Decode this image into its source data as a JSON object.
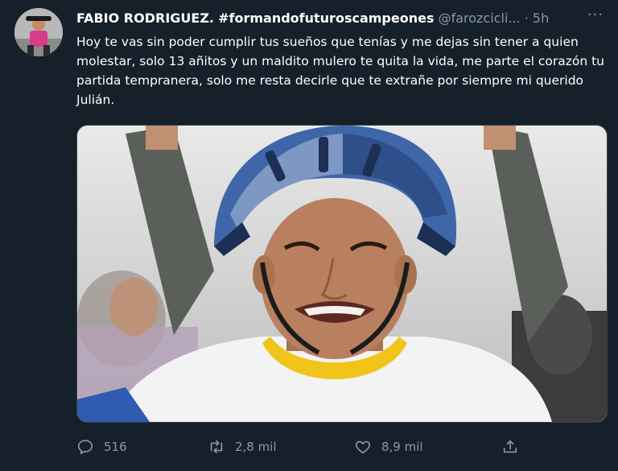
{
  "author": {
    "name": "FABIO RODRIGUEZ.",
    "hashtag": "#formandofuturoscampeones",
    "handle": "@farozcicli...",
    "separator": "·",
    "time": "5h"
  },
  "more_menu_glyph": "···",
  "tweet_text": "Hoy te vas sin poder cumplir tus sueños que tenías y me dejas sin tener a quien molestar, solo 13 añitos y un maldito mulero te quita la vida, me parte el corazón tu partida tempranera, solo me resta decirle que te extrañe por siempre mi querido Julián.",
  "actions": {
    "reply_count": "516",
    "retweet_count": "2,8 mil",
    "like_count": "8,9 mil"
  },
  "colors": {
    "background": "#15202b",
    "muted_text": "#8899a6",
    "helmet_blue": "#3f66a8",
    "jersey_yellow": "#f0c419"
  },
  "icons": [
    "reply-icon",
    "retweet-icon",
    "like-icon",
    "share-icon",
    "more-icon"
  ]
}
